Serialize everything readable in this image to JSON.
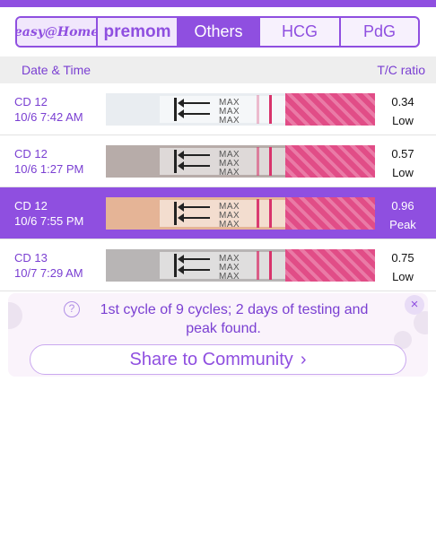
{
  "tabs": {
    "brand1": "easy@Home",
    "brand2": "premom",
    "items": [
      "Others",
      "HCG",
      "PdG"
    ],
    "active": "Others"
  },
  "table": {
    "col_date": "Date & Time",
    "col_ratio": "T/C ratio",
    "strip_mark": "MAX",
    "rows": [
      {
        "cd": "CD 12",
        "dt": "10/6 7:42 AM",
        "ratio": "0.34",
        "status": "Low",
        "highlighted": false,
        "test_line": 0.3
      },
      {
        "cd": "CD 12",
        "dt": "10/6 1:27 PM",
        "ratio": "0.57",
        "status": "Low",
        "highlighted": false,
        "test_line": 0.55
      },
      {
        "cd": "CD 12",
        "dt": "10/6 7:55 PM",
        "ratio": "0.96",
        "status": "Peak",
        "highlighted": true,
        "test_line": 0.95
      },
      {
        "cd": "CD 13",
        "dt": "10/7 7:29 AM",
        "ratio": "0.75",
        "status": "Low",
        "highlighted": false,
        "test_line": 0.75
      }
    ]
  },
  "banner": {
    "message": "1st cycle of 9 cycles; 2 days of testing and peak found.",
    "share_label": "Share to Community",
    "share_chevron": "›",
    "close_glyph": "×",
    "help_glyph": "?"
  },
  "colors": {
    "accent": "#8f4fe0",
    "strip_backgrounds": [
      "#e9edf1",
      "#b7aca9",
      "#e5b496",
      "#b8b5b5"
    ]
  }
}
